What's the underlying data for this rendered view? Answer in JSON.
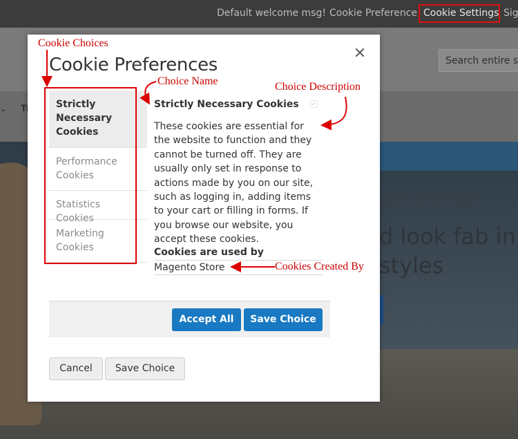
{
  "topbar": {
    "welcome": "Default welcome msg!",
    "cookie_preference": "Cookie Preference",
    "cookie_settings": "Cookie Settings",
    "sign_in_partial": "Sig"
  },
  "header": {
    "search_placeholder": "Search entire st"
  },
  "nav": {
    "partial_item": "Tr"
  },
  "hero": {
    "line1": "ga Collection",
    "line2": "d look fab in n",
    "line3": "styles"
  },
  "modal": {
    "title": "Cookie Preferences",
    "choices": [
      {
        "label": "Strictly Necessary Cookies",
        "active": true
      },
      {
        "label": "Performance Cookies",
        "active": false
      },
      {
        "label": "Statistics Cookies",
        "active": false
      },
      {
        "label": "Marketing Cookies",
        "active": false
      }
    ],
    "detail": {
      "name": "Strictly Necessary Cookies",
      "description": "These cookies are essential for the website to function and they cannot be turned off. They are usually only set in response to actions made by you on our site, such as logging in, adding items to your cart or filling in forms. If you browse our website, you accept these cookies.",
      "used_by_heading": "Cookies are used by",
      "used_by_value": "Magento Store"
    },
    "buttons": {
      "accept_all": "Accept All",
      "save_choice_primary": "Save Choice",
      "cancel": "Cancel",
      "save_choice_secondary": "Save Choice"
    }
  },
  "annotations": {
    "cookie_choices": "Cookie Choices",
    "choice_name": "Choice Name",
    "choice_description": "Choice Description",
    "cookies_created_by": "Cookies Created By"
  },
  "colors": {
    "primary_button": "#1979c3",
    "annotation_red": "#cc0000",
    "topbar": "#3c3c3c"
  }
}
